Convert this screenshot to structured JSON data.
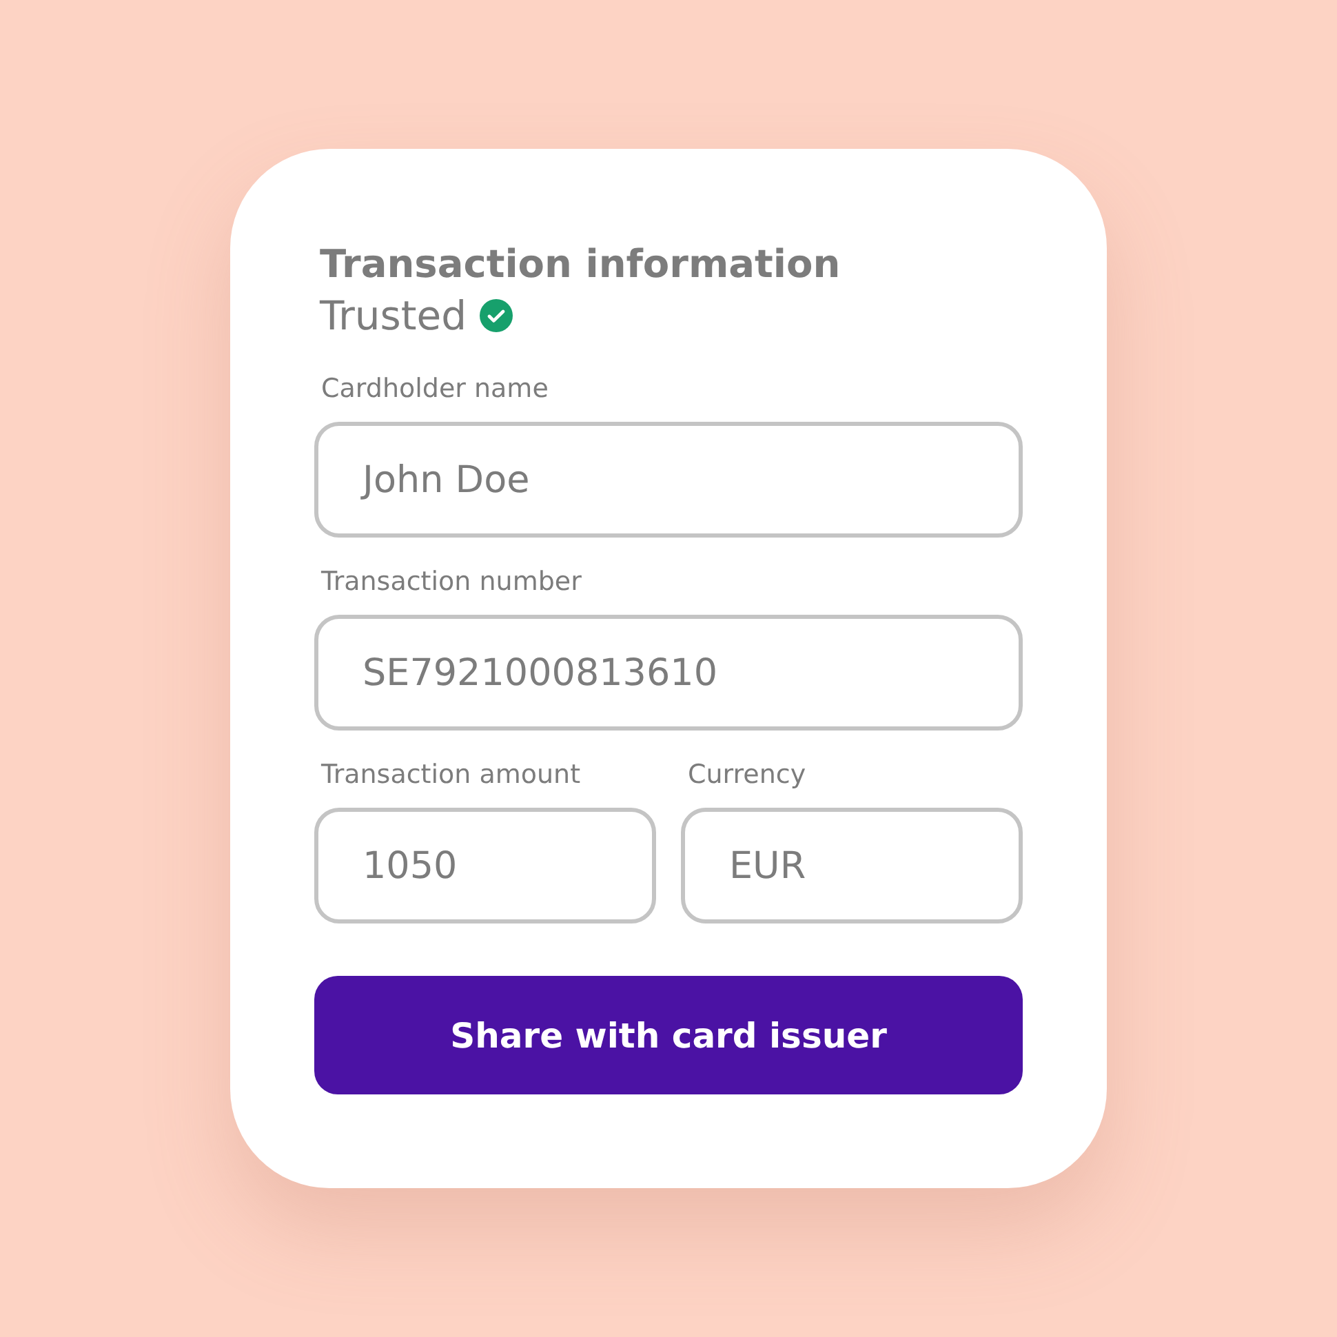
{
  "card": {
    "title": "Transaction information",
    "status": {
      "label": "Trusted",
      "verified": true
    }
  },
  "fields": [
    {
      "label": "Cardholder name",
      "value": "John Doe"
    },
    {
      "label": "Transaction number",
      "value": "SE7921000813610"
    }
  ],
  "row_fields": [
    {
      "label": "Transaction amount",
      "value": "1050"
    },
    {
      "label": "Currency",
      "value": "EUR"
    }
  ],
  "button": {
    "label": "Share with card issuer"
  }
}
